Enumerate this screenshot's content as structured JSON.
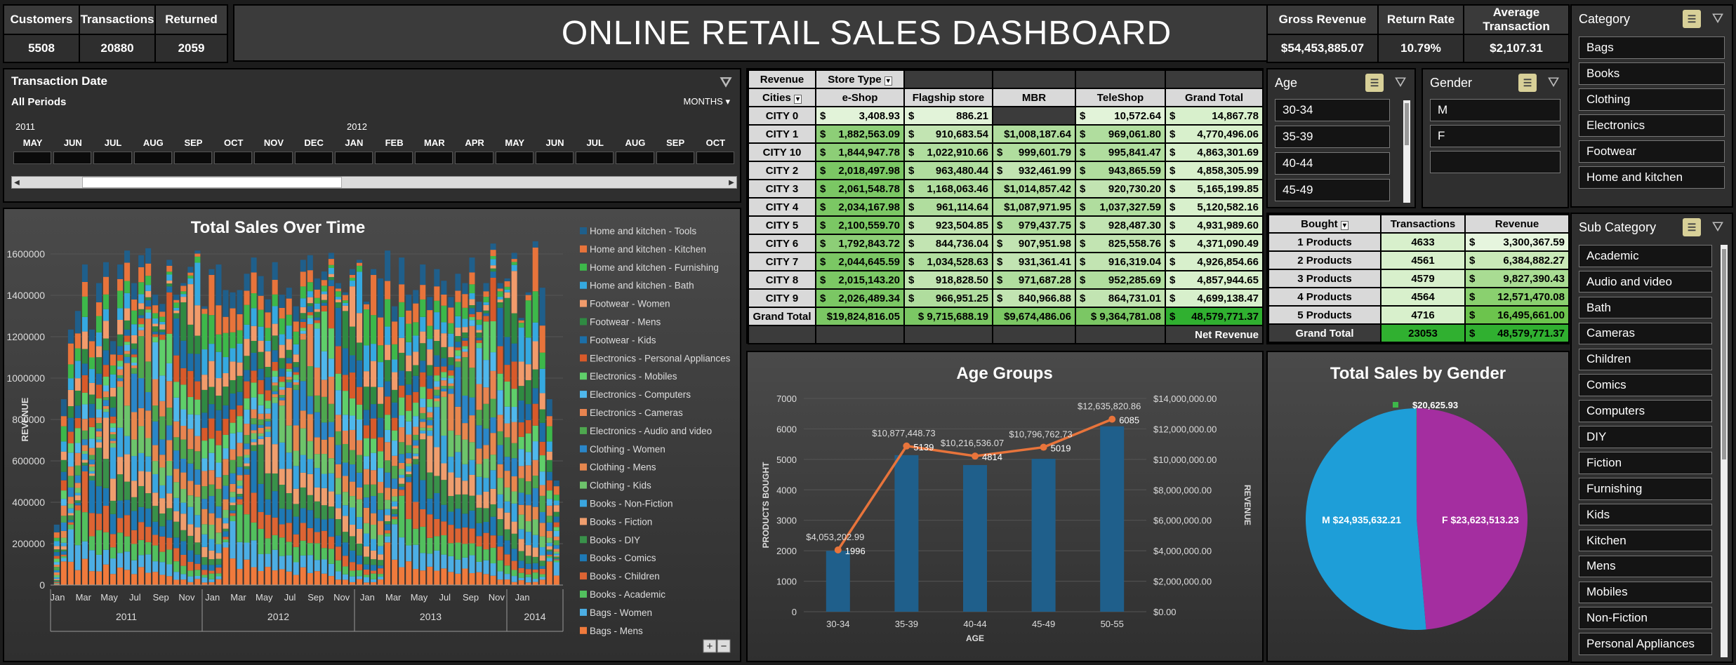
{
  "kpi_left": {
    "customers_label": "Customers",
    "customers_value": "5508",
    "transactions_label": "Transactions",
    "transactions_value": "20880",
    "returned_label": "Returned",
    "returned_value": "2059"
  },
  "title": "ONLINE RETAIL SALES DASHBOARD",
  "kpi_right": {
    "gross_label": "Gross Revenue",
    "gross_value": "$54,453,885.07",
    "rate_label": "Return Rate",
    "rate_value": "10.79%",
    "avg_label": "Average Transaction",
    "avg_value": "$2,107.31"
  },
  "timeline": {
    "title": "Transaction Date",
    "period": "All Periods",
    "level": "MONTHS",
    "years": [
      "2011",
      "2012"
    ],
    "months": [
      "MAY",
      "JUN",
      "JUL",
      "AUG",
      "SEP",
      "OCT",
      "NOV",
      "DEC",
      "JAN",
      "FEB",
      "MAR",
      "APR",
      "MAY",
      "JUN",
      "JUL",
      "AUG",
      "SEP",
      "OCT"
    ]
  },
  "revenue_table": {
    "corner": "Revenue",
    "col_field": "Store Type",
    "row_field": "Cities",
    "columns": [
      "e-Shop",
      "Flagship store",
      "MBR",
      "TeleShop",
      "Grand Total"
    ],
    "rows": [
      {
        "label": "CITY 0",
        "values": [
          "3,408.93",
          "886.21",
          "",
          "10,572.64",
          "14,867.78"
        ]
      },
      {
        "label": "CITY 1",
        "values": [
          "1,882,563.09",
          "910,683.54",
          "$1,008,187.64",
          "969,061.80",
          "4,770,496.06"
        ]
      },
      {
        "label": "CITY 10",
        "values": [
          "1,844,947.78",
          "1,022,910.66",
          "999,601.79",
          "995,841.47",
          "4,863,301.69"
        ]
      },
      {
        "label": "CITY 2",
        "values": [
          "2,018,497.98",
          "963,480.44",
          "932,461.99",
          "943,865.59",
          "4,858,305.99"
        ]
      },
      {
        "label": "CITY 3",
        "values": [
          "2,061,548.78",
          "1,168,063.46",
          "$1,014,857.42",
          "920,730.20",
          "5,165,199.85"
        ]
      },
      {
        "label": "CITY 4",
        "values": [
          "2,034,167.98",
          "961,114.64",
          "$1,087,971.95",
          "1,037,327.59",
          "5,120,582.16"
        ]
      },
      {
        "label": "CITY 5",
        "values": [
          "2,100,559.70",
          "923,504.85",
          "979,437.75",
          "928,487.30",
          "4,931,989.60"
        ]
      },
      {
        "label": "CITY 6",
        "values": [
          "1,792,843.72",
          "844,736.04",
          "907,951.98",
          "825,558.76",
          "4,371,090.49"
        ]
      },
      {
        "label": "CITY 7",
        "values": [
          "2,044,645.59",
          "1,034,528.63",
          "931,361.41",
          "916,319.04",
          "4,926,854.66"
        ]
      },
      {
        "label": "CITY 8",
        "values": [
          "2,015,143.20",
          "918,828.50",
          "971,687.28",
          "952,285.69",
          "4,857,944.65"
        ]
      },
      {
        "label": "CITY 9",
        "values": [
          "2,026,489.34",
          "966,951.25",
          "840,966.88",
          "864,731.01",
          "4,699,138.47"
        ]
      }
    ],
    "grand_label": "Grand Total",
    "grand_values": [
      "$19,824,816.05",
      "$ 9,715,688.19",
      "$9,674,486.06",
      "$ 9,364,781.08",
      "48,579,771.37"
    ],
    "footer": "Net Revenue"
  },
  "age_slicer": {
    "title": "Age",
    "items": [
      "30-34",
      "35-39",
      "40-44",
      "45-49"
    ]
  },
  "gender_slicer": {
    "title": "Gender",
    "items": [
      "M",
      "F",
      ""
    ]
  },
  "category_slicer": {
    "title": "Category",
    "items": [
      "Bags",
      "Books",
      "Clothing",
      "Electronics",
      "Footwear",
      "Home and kitchen"
    ]
  },
  "subcategory_slicer": {
    "title": "Sub Category",
    "items": [
      "Academic",
      "Audio and video",
      "Bath",
      "Cameras",
      "Children",
      "Comics",
      "Computers",
      "DIY",
      "Fiction",
      "Furnishing",
      "Kids",
      "Kitchen",
      "Mens",
      "Mobiles",
      "Non-Fiction",
      "Personal Appliances"
    ]
  },
  "bought_table": {
    "headers": [
      "Bought",
      "Transactions",
      "Revenue"
    ],
    "rows": [
      {
        "label": "1 Products",
        "tx": "4633",
        "rev": "3,300,367.59"
      },
      {
        "label": "2 Products",
        "tx": "4561",
        "rev": "6,384,882.27"
      },
      {
        "label": "3 Products",
        "tx": "4579",
        "rev": "9,827,390.43"
      },
      {
        "label": "4 Products",
        "tx": "4564",
        "rev": "12,571,470.08"
      },
      {
        "label": "5 Products",
        "tx": "4716",
        "rev": "16,495,661.00"
      }
    ],
    "grand_label": "Grand Total",
    "grand_tx": "23053",
    "grand_rev": "48,579,771.37"
  },
  "colors": {
    "revenue_bar": "#1f5f8b",
    "line": "#e8743b",
    "male": "#1e9ed8",
    "female": "#a42ea0"
  },
  "chart_data": [
    {
      "type": "bar",
      "stacked": true,
      "title": "Total Sales Over Time",
      "ylabel": "REVENUE",
      "ylim": [
        0,
        1600000
      ],
      "yticks": [
        "0",
        "200000",
        "400000",
        "600000",
        "800000",
        "1000000",
        "1200000",
        "1400000",
        "1600000"
      ],
      "x_month_labels": [
        "Jan",
        "Mar",
        "May",
        "Jul",
        "Sep",
        "Nov",
        "Jan",
        "Mar",
        "May",
        "Jul",
        "Sep",
        "Nov",
        "Jan",
        "Mar",
        "May",
        "Jul",
        "Sep",
        "Nov",
        "Jan"
      ],
      "x_years": [
        "2011",
        "2012",
        "2013",
        "2014"
      ],
      "legend": [
        "Home and kitchen - Tools",
        "Home and kitchen - Kitchen",
        "Home and kitchen - Furnishing",
        "Home and kitchen - Bath",
        "Footwear - Women",
        "Footwear - Mens",
        "Footwear - Kids",
        "Electronics - Personal Appliances",
        "Electronics - Mobiles",
        "Electronics - Computers",
        "Electronics - Cameras",
        "Electronics - Audio and video",
        "Clothing - Women",
        "Clothing - Mens",
        "Clothing - Kids",
        "Books - Non-Fiction",
        "Books - Fiction",
        "Books - DIY",
        "Books - Comics",
        "Books - Children",
        "Books - Academic",
        "Bags - Women",
        "Bags - Mens"
      ],
      "legend_colors": [
        "#1f5f8b",
        "#e8743b",
        "#3db84a",
        "#35a9e0",
        "#f29b6b",
        "#2f8a42",
        "#1c6fa8",
        "#d85a2a",
        "#5fcf6a",
        "#4fb8ec",
        "#e88450",
        "#4ea74f",
        "#2a86c8",
        "#e7874e",
        "#6dc46b",
        "#3aa6df",
        "#ef9e6e",
        "#39914a",
        "#1e79b5",
        "#dd6433",
        "#52c05e",
        "#4caee4",
        "#f07a3c"
      ],
      "totals": [
        260000,
        800000,
        1100000,
        1180000,
        1380000,
        1100000,
        1300000,
        1390000,
        1050000,
        1380000,
        1440000,
        1300000,
        1420000,
        1450000,
        1250000,
        1210000,
        1400000,
        1250000,
        1300000,
        1370000,
        1440000,
        1200000,
        1360000,
        1380000,
        1270000,
        1260000,
        1270000,
        1340000,
        1410000,
        1330000,
        1230000,
        1390000,
        1250000,
        1280000,
        1200000,
        1400000,
        1420000,
        1320000,
        1350000,
        1430000,
        1300000,
        1260000,
        1360000,
        1400000,
        1220000,
        1360000,
        1320000,
        1440000,
        1200000,
        1410000,
        1250000,
        1270000,
        1380000,
        1240000,
        1360000,
        1310000,
        1240000,
        1340000,
        1300000,
        1410000,
        1220000,
        1300000,
        1470000,
        1300000,
        1320000,
        1430000,
        1150000,
        1260000,
        1480000,
        1280000,
        800000,
        450000
      ]
    },
    {
      "type": "bar",
      "title": "Age Groups",
      "categories": [
        "30-34",
        "35-39",
        "40-44",
        "45-49",
        "50-55"
      ],
      "series": [
        {
          "values": [
            1996,
            5139,
            4814,
            5019,
            6085
          ]
        },
        {
          "values": [
            4053202.99,
            10877448.73,
            10216536.07,
            10796762.73,
            12635820.86
          ]
        }
      ],
      "bar_labels": [
        "1996",
        "5139",
        "4814",
        "5019",
        "6085"
      ],
      "line_labels": [
        "$4,053,202.99",
        "$10,877,448.73",
        "$10,216,536.07",
        "$10,796,762.73",
        "$12,635,820.86"
      ],
      "xlabel": "AGE",
      "ylabel": "PRODUCTS BOUGHT",
      "y2label": "REVENUE",
      "ylim": [
        0,
        7000
      ],
      "y2lim": [
        0,
        14000000
      ],
      "yticks": [
        "0",
        "1000",
        "2000",
        "3000",
        "4000",
        "5000",
        "6000",
        "7000"
      ],
      "y2ticks": [
        "$0.00",
        "$2,000,000.00",
        "$4,000,000.00",
        "$6,000,000.00",
        "$8,000,000.00",
        "$10,000,000.00",
        "$12,000,000.00",
        "$14,000,000.00"
      ]
    },
    {
      "type": "pie",
      "title": "Total Sales by Gender",
      "values": [
        24935632.21,
        23623513.23,
        20625.93
      ],
      "labels": [
        "M $24,935,632.21",
        "F $23,623,513.23",
        "$20,625.93"
      ],
      "colors": [
        "#1e9ed8",
        "#a42ea0",
        "#3db84a"
      ]
    }
  ]
}
